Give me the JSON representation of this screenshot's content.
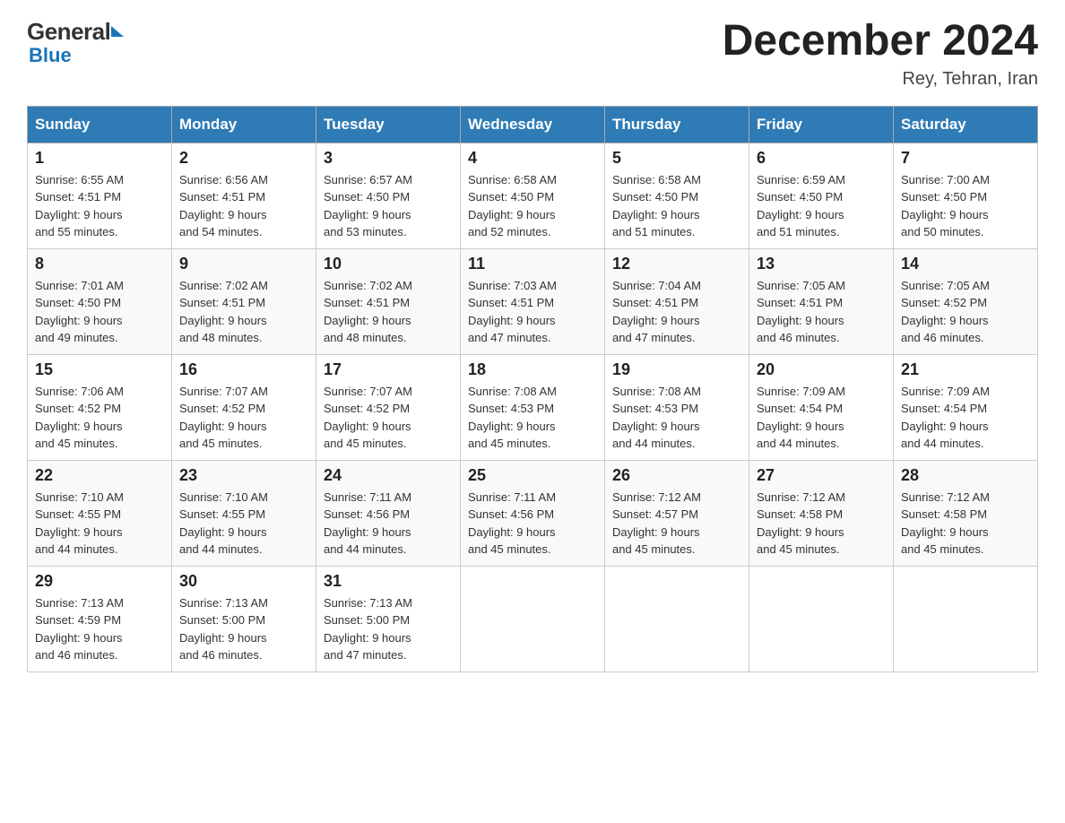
{
  "header": {
    "logo_general": "General",
    "logo_blue": "Blue",
    "title": "December 2024",
    "subtitle": "Rey, Tehran, Iran"
  },
  "days_of_week": [
    "Sunday",
    "Monday",
    "Tuesday",
    "Wednesday",
    "Thursday",
    "Friday",
    "Saturday"
  ],
  "weeks": [
    [
      {
        "day": "1",
        "sunrise": "6:55 AM",
        "sunset": "4:51 PM",
        "daylight": "9 hours and 55 minutes."
      },
      {
        "day": "2",
        "sunrise": "6:56 AM",
        "sunset": "4:51 PM",
        "daylight": "9 hours and 54 minutes."
      },
      {
        "day": "3",
        "sunrise": "6:57 AM",
        "sunset": "4:50 PM",
        "daylight": "9 hours and 53 minutes."
      },
      {
        "day": "4",
        "sunrise": "6:58 AM",
        "sunset": "4:50 PM",
        "daylight": "9 hours and 52 minutes."
      },
      {
        "day": "5",
        "sunrise": "6:58 AM",
        "sunset": "4:50 PM",
        "daylight": "9 hours and 51 minutes."
      },
      {
        "day": "6",
        "sunrise": "6:59 AM",
        "sunset": "4:50 PM",
        "daylight": "9 hours and 51 minutes."
      },
      {
        "day": "7",
        "sunrise": "7:00 AM",
        "sunset": "4:50 PM",
        "daylight": "9 hours and 50 minutes."
      }
    ],
    [
      {
        "day": "8",
        "sunrise": "7:01 AM",
        "sunset": "4:50 PM",
        "daylight": "9 hours and 49 minutes."
      },
      {
        "day": "9",
        "sunrise": "7:02 AM",
        "sunset": "4:51 PM",
        "daylight": "9 hours and 48 minutes."
      },
      {
        "day": "10",
        "sunrise": "7:02 AM",
        "sunset": "4:51 PM",
        "daylight": "9 hours and 48 minutes."
      },
      {
        "day": "11",
        "sunrise": "7:03 AM",
        "sunset": "4:51 PM",
        "daylight": "9 hours and 47 minutes."
      },
      {
        "day": "12",
        "sunrise": "7:04 AM",
        "sunset": "4:51 PM",
        "daylight": "9 hours and 47 minutes."
      },
      {
        "day": "13",
        "sunrise": "7:05 AM",
        "sunset": "4:51 PM",
        "daylight": "9 hours and 46 minutes."
      },
      {
        "day": "14",
        "sunrise": "7:05 AM",
        "sunset": "4:52 PM",
        "daylight": "9 hours and 46 minutes."
      }
    ],
    [
      {
        "day": "15",
        "sunrise": "7:06 AM",
        "sunset": "4:52 PM",
        "daylight": "9 hours and 45 minutes."
      },
      {
        "day": "16",
        "sunrise": "7:07 AM",
        "sunset": "4:52 PM",
        "daylight": "9 hours and 45 minutes."
      },
      {
        "day": "17",
        "sunrise": "7:07 AM",
        "sunset": "4:52 PM",
        "daylight": "9 hours and 45 minutes."
      },
      {
        "day": "18",
        "sunrise": "7:08 AM",
        "sunset": "4:53 PM",
        "daylight": "9 hours and 45 minutes."
      },
      {
        "day": "19",
        "sunrise": "7:08 AM",
        "sunset": "4:53 PM",
        "daylight": "9 hours and 44 minutes."
      },
      {
        "day": "20",
        "sunrise": "7:09 AM",
        "sunset": "4:54 PM",
        "daylight": "9 hours and 44 minutes."
      },
      {
        "day": "21",
        "sunrise": "7:09 AM",
        "sunset": "4:54 PM",
        "daylight": "9 hours and 44 minutes."
      }
    ],
    [
      {
        "day": "22",
        "sunrise": "7:10 AM",
        "sunset": "4:55 PM",
        "daylight": "9 hours and 44 minutes."
      },
      {
        "day": "23",
        "sunrise": "7:10 AM",
        "sunset": "4:55 PM",
        "daylight": "9 hours and 44 minutes."
      },
      {
        "day": "24",
        "sunrise": "7:11 AM",
        "sunset": "4:56 PM",
        "daylight": "9 hours and 44 minutes."
      },
      {
        "day": "25",
        "sunrise": "7:11 AM",
        "sunset": "4:56 PM",
        "daylight": "9 hours and 45 minutes."
      },
      {
        "day": "26",
        "sunrise": "7:12 AM",
        "sunset": "4:57 PM",
        "daylight": "9 hours and 45 minutes."
      },
      {
        "day": "27",
        "sunrise": "7:12 AM",
        "sunset": "4:58 PM",
        "daylight": "9 hours and 45 minutes."
      },
      {
        "day": "28",
        "sunrise": "7:12 AM",
        "sunset": "4:58 PM",
        "daylight": "9 hours and 45 minutes."
      }
    ],
    [
      {
        "day": "29",
        "sunrise": "7:13 AM",
        "sunset": "4:59 PM",
        "daylight": "9 hours and 46 minutes."
      },
      {
        "day": "30",
        "sunrise": "7:13 AM",
        "sunset": "5:00 PM",
        "daylight": "9 hours and 46 minutes."
      },
      {
        "day": "31",
        "sunrise": "7:13 AM",
        "sunset": "5:00 PM",
        "daylight": "9 hours and 47 minutes."
      },
      null,
      null,
      null,
      null
    ]
  ],
  "labels": {
    "sunrise": "Sunrise:",
    "sunset": "Sunset:",
    "daylight": "Daylight:"
  },
  "colors": {
    "header_bg": "#2e7bb5",
    "header_text": "#ffffff",
    "border": "#aaaaaa",
    "logo_blue": "#1a75b8"
  }
}
